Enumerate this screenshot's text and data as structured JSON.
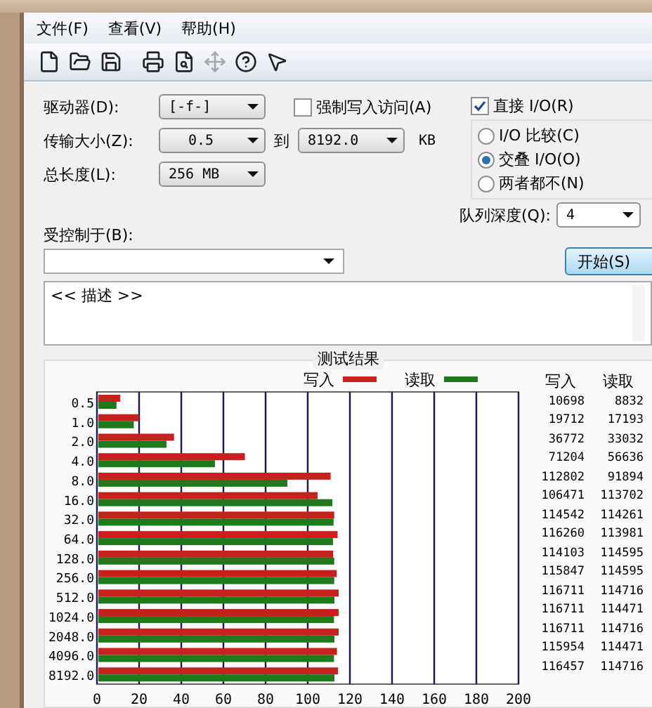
{
  "menu": [
    "文件(F)",
    "查看(V)",
    "帮助(H)"
  ],
  "toolbar": [
    {
      "kind": "new",
      "disabled": false
    },
    {
      "kind": "open",
      "disabled": false
    },
    {
      "kind": "save",
      "disabled": false
    },
    {
      "kind": "print",
      "disabled": false
    },
    {
      "kind": "preview",
      "disabled": false
    },
    {
      "kind": "move",
      "disabled": true
    },
    {
      "kind": "help",
      "disabled": false
    },
    {
      "kind": "context-help",
      "disabled": false
    }
  ],
  "drive": {
    "label": "驱动器(D):",
    "value": "[-f-]"
  },
  "force_write": {
    "label": "强制写入访问(A)",
    "checked": false
  },
  "direct_io": {
    "label": "直接 I/O(R)",
    "checked": true
  },
  "transfer_size": {
    "label": "传输大小(Z):",
    "from": "0.5",
    "to_label": "到",
    "to": "8192.0",
    "unit": "KB"
  },
  "total_length": {
    "label": "总长度(L):",
    "value": "256 MB"
  },
  "io_mode": [
    {
      "label": "I/O 比较(C)",
      "selected": false
    },
    {
      "label": "交叠 I/O(O)",
      "selected": true
    },
    {
      "label": "两者都不(N)",
      "selected": false
    }
  ],
  "queue_depth": {
    "label": "队列深度(Q):",
    "value": "4"
  },
  "controlled_by": {
    "label": "受控制于(B):"
  },
  "start_button": "开始(S)",
  "description": "<< 描述 >>",
  "results": {
    "title": "测试结果",
    "chart_data": {
      "type": "bar",
      "orientation": "horizontal",
      "grid": true,
      "categories": [
        "0.5",
        "1.0",
        "2.0",
        "4.0",
        "8.0",
        "16.0",
        "32.0",
        "64.0",
        "128.0",
        "256.0",
        "512.0",
        "1024.0",
        "2048.0",
        "4096.0",
        "8192.0"
      ],
      "xlim": [
        0,
        200
      ],
      "xticks": [
        0,
        20,
        40,
        60,
        80,
        100,
        120,
        140,
        160,
        180,
        200
      ],
      "series": [
        {
          "name": "写入",
          "color": "#c8201c",
          "values": [
            10.4,
            19.3,
            35.9,
            69.5,
            110.2,
            104.0,
            111.9,
            113.5,
            111.4,
            113.1,
            114.0,
            114.0,
            114.0,
            113.2,
            113.7
          ]
        },
        {
          "name": "读取",
          "color": "#1e7a1a",
          "values": [
            8.6,
            16.8,
            32.3,
            55.3,
            89.7,
            111.0,
            111.6,
            111.3,
            111.9,
            111.9,
            112.0,
            111.8,
            112.0,
            111.8,
            112.0
          ]
        }
      ]
    },
    "columns": [
      "写入",
      "读取"
    ],
    "rows": [
      [
        "10698",
        "8832"
      ],
      [
        "19712",
        "17193"
      ],
      [
        "36772",
        "33032"
      ],
      [
        "71204",
        "56636"
      ],
      [
        "112802",
        "91894"
      ],
      [
        "106471",
        "113702"
      ],
      [
        "114542",
        "114261"
      ],
      [
        "116260",
        "113981"
      ],
      [
        "114103",
        "114595"
      ],
      [
        "115847",
        "114595"
      ],
      [
        "116711",
        "114716"
      ],
      [
        "116711",
        "114471"
      ],
      [
        "116711",
        "114716"
      ],
      [
        "115954",
        "114471"
      ],
      [
        "116457",
        "114716"
      ]
    ]
  }
}
